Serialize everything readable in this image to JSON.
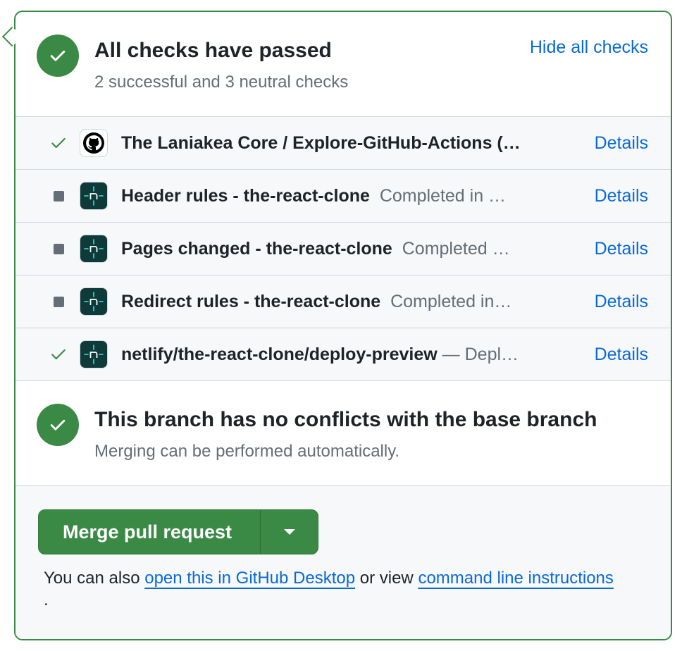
{
  "checks_summary": {
    "title": "All checks have passed",
    "subtitle": "2 successful and 3 neutral checks",
    "hide_link": "Hide all checks"
  },
  "checks": [
    {
      "status": "success",
      "icon": "github-icon",
      "name": "The Laniakea Core / Explore-GitHub-Actions (…",
      "desc": "",
      "details": "Details"
    },
    {
      "status": "neutral",
      "icon": "netlify-icon",
      "name": "Header rules - the-react-clone",
      "desc": "Completed in …",
      "details": "Details"
    },
    {
      "status": "neutral",
      "icon": "netlify-icon",
      "name": "Pages changed - the-react-clone",
      "desc": "Completed …",
      "details": "Details"
    },
    {
      "status": "neutral",
      "icon": "netlify-icon",
      "name": "Redirect rules - the-react-clone",
      "desc": "Completed in…",
      "details": "Details"
    },
    {
      "status": "success",
      "icon": "netlify-icon",
      "name": "netlify/the-react-clone/deploy-preview",
      "desc": "— Depl…",
      "details": "Details"
    }
  ],
  "conflicts": {
    "title": "This branch has no conflicts with the base branch",
    "subtitle": "Merging can be performed automatically."
  },
  "merge": {
    "button_label": "Merge pull request",
    "also_prefix": "You can also",
    "desktop_link": "open this in GitHub Desktop",
    "or_view": "or view",
    "cli_link": "command line instructions",
    "trailing": "."
  },
  "colors": {
    "success": "#3a8a45",
    "link": "#0969da",
    "muted": "#656d76",
    "netlify_bg": "#0e3a3a",
    "netlify_accent": "#32e6e2"
  }
}
